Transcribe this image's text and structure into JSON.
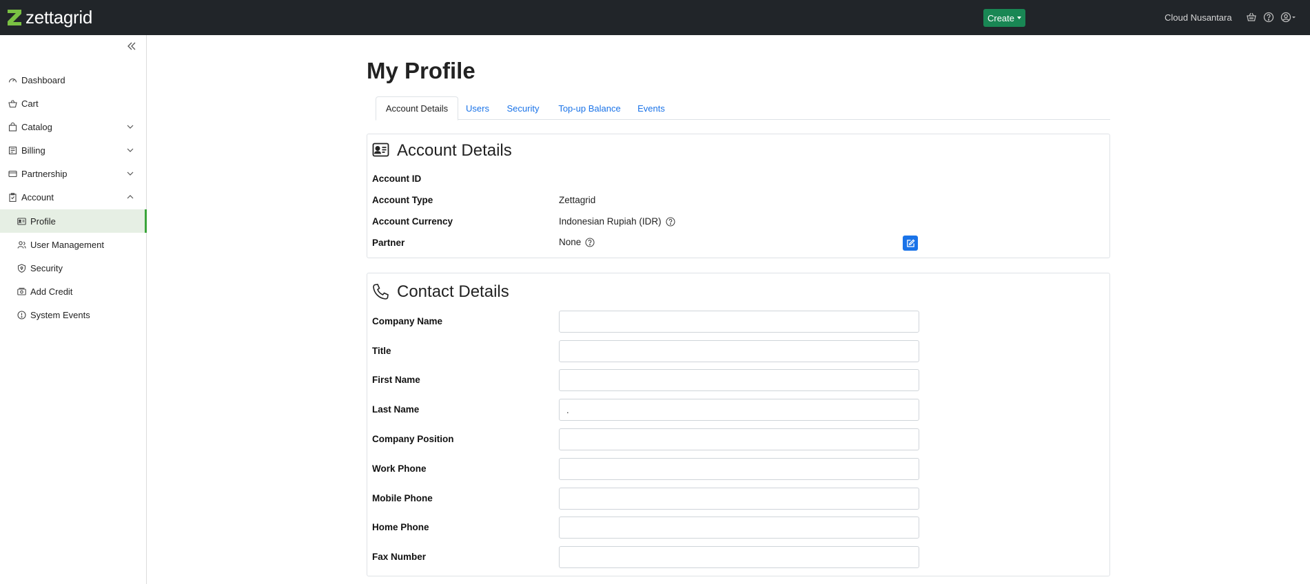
{
  "topbar": {
    "brand": "zettagrid",
    "create_label": "Create",
    "org_name": "Cloud Nusantara",
    "icons": [
      "basket-icon",
      "help-icon",
      "user-circle-icon"
    ]
  },
  "sidebar": {
    "items": [
      {
        "label": "Dashboard",
        "icon": "dashboard-icon"
      },
      {
        "label": "Cart",
        "icon": "basket-icon"
      },
      {
        "label": "Catalog",
        "icon": "bag-icon"
      },
      {
        "label": "Billing",
        "icon": "receipt-icon"
      },
      {
        "label": "Partnership",
        "icon": "partnership-icon"
      },
      {
        "label": "Account",
        "icon": "clipboard-icon"
      }
    ],
    "sub_items": [
      {
        "label": "Profile",
        "icon": "id-card-icon",
        "active": true
      },
      {
        "label": "User Management",
        "icon": "users-icon"
      },
      {
        "label": "Security",
        "icon": "shield-icon"
      },
      {
        "label": "Add Credit",
        "icon": "cash-icon"
      },
      {
        "label": "System Events",
        "icon": "info-icon"
      }
    ]
  },
  "main": {
    "title": "My Profile",
    "tabs": [
      {
        "label": "Account Details",
        "active": true
      },
      {
        "label": "Users"
      },
      {
        "label": "Security"
      },
      {
        "label": "Top-up Balance"
      },
      {
        "label": "Events"
      }
    ],
    "account_card": {
      "title": "Account Details",
      "rows": [
        {
          "label": "Account ID",
          "value": ""
        },
        {
          "label": "Account Type",
          "value": "Zettagrid"
        },
        {
          "label": "Account Currency",
          "value": "Indonesian Rupiah (IDR)"
        },
        {
          "label": "Partner",
          "value": "None"
        }
      ]
    },
    "contact_card": {
      "title": "Contact Details",
      "fields": [
        {
          "label": "Company Name",
          "value": ""
        },
        {
          "label": "Title",
          "value": ""
        },
        {
          "label": "First Name",
          "value": ""
        },
        {
          "label": "Last Name",
          "value": "."
        },
        {
          "label": "Company Position",
          "value": ""
        },
        {
          "label": "Work Phone",
          "value": ""
        },
        {
          "label": "Mobile Phone",
          "value": ""
        },
        {
          "label": "Home Phone",
          "value": ""
        },
        {
          "label": "Fax Number",
          "value": ""
        }
      ]
    }
  },
  "colors": {
    "topbar": "#212529",
    "create_button": "#198754",
    "link": "#1a73e8",
    "brand_green": "#7ac143",
    "active_bg": "#e6efe4",
    "active_border": "#3aa53a"
  }
}
